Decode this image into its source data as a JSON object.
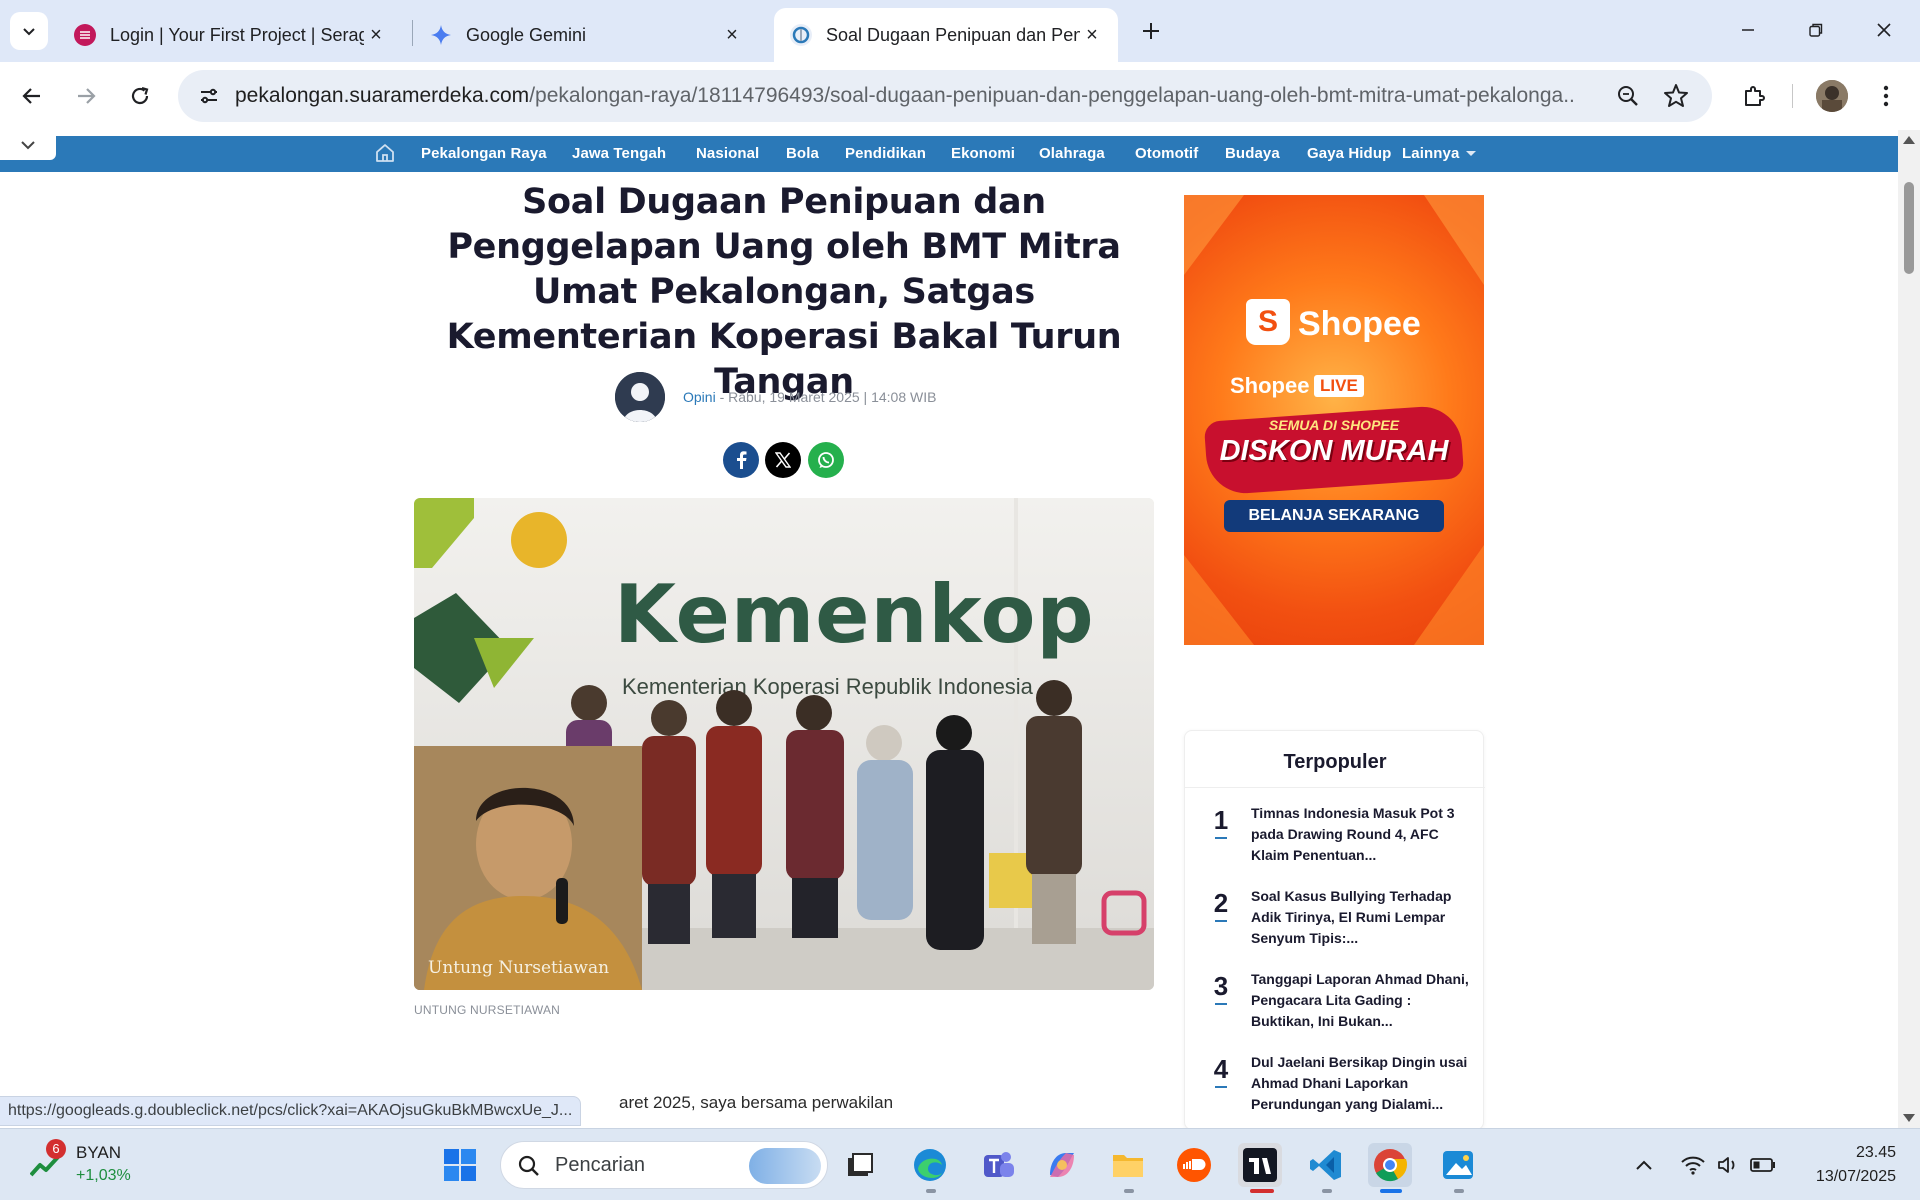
{
  "tabs": [
    {
      "title": "Login | Your First Project | Serag",
      "icon": "serag-favicon"
    },
    {
      "title": "Google Gemini",
      "icon": "gemini-favicon"
    },
    {
      "title": "Soal Dugaan Penipuan dan Peng",
      "icon": "suaramerdeka-favicon",
      "active": true
    }
  ],
  "omnibox": {
    "host": "pekalongan.suaramerdeka.com",
    "path": "/pekalongan-raya/18114796493/soal-dugaan-penipuan-dan-penggelapan-uang-oleh-bmt-mitra-umat-pekalonga..."
  },
  "nav": {
    "items": [
      "Pekalongan Raya",
      "Jawa Tengah",
      "Nasional",
      "Bola",
      "Pendidikan",
      "Ekonomi",
      "Olahraga",
      "Otomotif",
      "Budaya",
      "Gaya Hidup"
    ],
    "more": "Lainnya"
  },
  "article": {
    "headline": "Soal Dugaan Penipuan dan Penggelapan Uang oleh BMT Mitra Umat Pekalongan, Satgas Kementerian Koperasi Bakal Turun Tangan",
    "author": "Opini",
    "date": " - Rabu, 19 Maret 2025 | 14:08 WIB",
    "image_caption": "UNTUNG NURSETIAWAN",
    "image_sign_text": "Kemenkop",
    "image_sign_subtext": "Kementerian Koperasi Republik Indonesia",
    "image_watermark": "Untung Nursetiawan",
    "body_visible": "aret 2025, saya bersama perwakilan"
  },
  "ad": {
    "brand": "Shopee",
    "live_label": "Shopee",
    "live_badge": "LIVE",
    "tagline_top": "SEMUA DI SHOPEE",
    "tagline_main": "DISKON MURAH",
    "cta": "BELANJA SEKARANG"
  },
  "popular": {
    "title": "Terpopuler",
    "items": [
      {
        "rank": "1",
        "text": "Timnas Indonesia Masuk Pot 3 pada Drawing Round 4, AFC Klaim Penentuan..."
      },
      {
        "rank": "2",
        "text": "Soal Kasus Bullying Terhadap Adik Tirinya, El Rumi Lempar Senyum Tipis:..."
      },
      {
        "rank": "3",
        "text": "Tanggapi Laporan Ahmad Dhani, Pengacara Lita Gading : Buktikan, Ini Bukan..."
      },
      {
        "rank": "4",
        "text": "Dul Jaelani Bersikap Dingin usai Ahmad Dhani Laporkan Perundungan yang Dialami..."
      }
    ]
  },
  "status_url": "https://googleads.g.doubleclick.net/pcs/click?xai=AKAOjsuGkuBkMBwcxUe_J...",
  "taskbar": {
    "widget_badge": "6",
    "widget_ticker": "BYAN",
    "widget_change": "+1,03%",
    "search_placeholder": "Pencarian",
    "time": "23.45",
    "date": "13/07/2025"
  },
  "colors": {
    "nav_blue": "#2b79b8",
    "headline": "#1a1a2e",
    "ad_orange": "#f25011",
    "widget_green": "#1e8e3e"
  }
}
